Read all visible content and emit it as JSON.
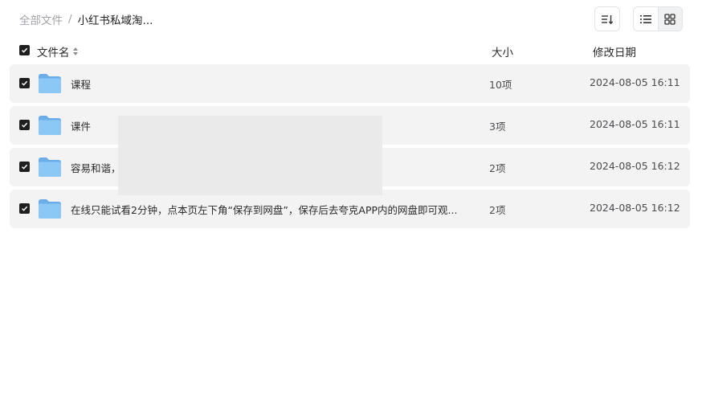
{
  "breadcrumb": {
    "root": "全部文件",
    "separator": "/",
    "current": "小红书私域淘..."
  },
  "toolbar": {
    "sort_icon": "sort-lines-icon",
    "list_view_icon": "list-view-icon",
    "grid_view_icon": "grid-view-icon",
    "active_view": "list"
  },
  "table": {
    "headers": {
      "name": "文件名",
      "size": "大小",
      "date": "修改日期"
    },
    "rows": [
      {
        "name": "课程",
        "size": "10项",
        "date": "2024-08-05 16:11",
        "checked": true
      },
      {
        "name": "课件",
        "size": "3项",
        "date": "2024-08-05 16:11",
        "checked": true
      },
      {
        "name": "容易和谐，",
        "size": "2项",
        "date": "2024-08-05 16:12",
        "checked": true
      },
      {
        "name": "在线只能试看2分钟，点本页左下角“保存到网盘”，保存后去夸克APP内的网盘即可观...",
        "size": "2项",
        "date": "2024-08-05 16:12",
        "checked": true
      }
    ]
  },
  "colors": {
    "row_bg": "#f3f3f4",
    "checkbox": "#1f1f1f",
    "folder_front": "#8cc8f5",
    "folder_back": "#6aaee9",
    "muted_text": "#a0a3a8"
  }
}
